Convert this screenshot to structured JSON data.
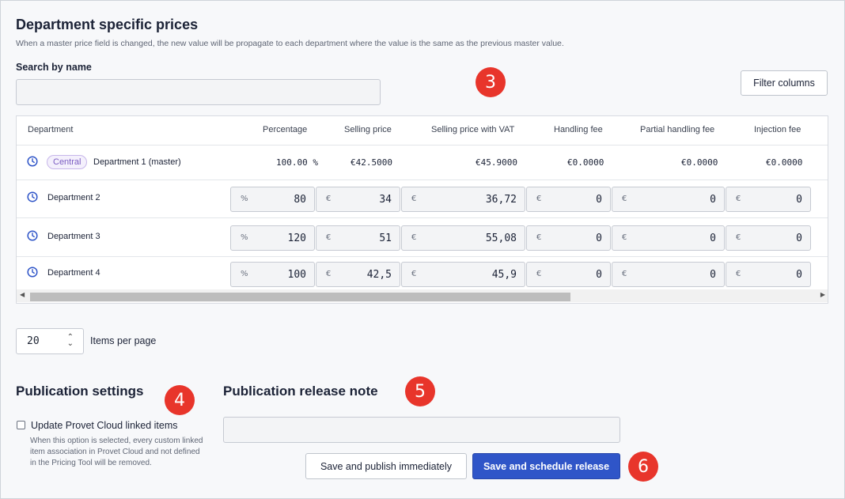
{
  "section": {
    "title": "Department specific prices",
    "description": "When a master price field is changed, the new value will be propagate to each department where the value is the same as the previous master value."
  },
  "search": {
    "label": "Search by name",
    "value": "",
    "placeholder": ""
  },
  "filter_button": "Filter columns",
  "annotations": {
    "a3": "3",
    "a4": "4",
    "a5": "5",
    "a6": "6"
  },
  "table": {
    "columns": [
      "Department",
      "Percentage",
      "Selling price",
      "Selling price with VAT",
      "Handling fee",
      "Partial handling fee",
      "Injection fee"
    ],
    "master": {
      "tag": "Central",
      "name": "Department 1 (master)",
      "values": [
        "100.00 %",
        "€42.5000",
        "€45.9000",
        "€0.0000",
        "€0.0000",
        "€0.0000"
      ]
    },
    "rows": [
      {
        "name": "Department 2",
        "values": [
          "80",
          "34",
          "36,72",
          "0",
          "0",
          "0"
        ]
      },
      {
        "name": "Department 3",
        "values": [
          "120",
          "51",
          "55,08",
          "0",
          "0",
          "0"
        ]
      },
      {
        "name": "Department 4",
        "values": [
          "100",
          "42,5",
          "45,9",
          "0",
          "0",
          "0"
        ]
      }
    ],
    "units": [
      "%",
      "€",
      "€",
      "€",
      "€",
      "€"
    ]
  },
  "pagination": {
    "per_page_value": "20",
    "label": "Items per page"
  },
  "publication_settings": {
    "title": "Publication settings",
    "checkbox_label": "Update Provet Cloud linked items",
    "checked": false,
    "help": "When this option is selected, every custom linked item association in Provet Cloud and not defined in the Pricing Tool will be removed."
  },
  "release_note": {
    "title": "Publication release note",
    "value": ""
  },
  "actions": {
    "publish_now": "Save and publish immediately",
    "schedule": "Save and schedule release"
  },
  "colors": {
    "primary": "#2f55c8",
    "annotation": "#e8352b",
    "tag": "#7b5cc2"
  },
  "icons": {
    "history": "clock-icon"
  }
}
